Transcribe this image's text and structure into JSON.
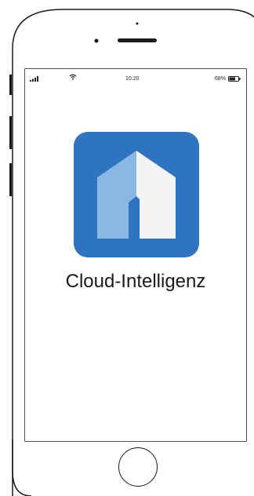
{
  "status_bar": {
    "time": "10:20",
    "battery_percent": "68%",
    "battery_level": 0.68,
    "signal_icon": "signal-bars-icon",
    "wifi_icon": "wifi-icon",
    "battery_icon": "battery-icon"
  },
  "app": {
    "name": "Cloud-Intelligenz",
    "icon": "house-icon",
    "icon_background": "#2f74c0",
    "house_light": "#8ab8e4",
    "house_white": "#f4f4f4"
  }
}
